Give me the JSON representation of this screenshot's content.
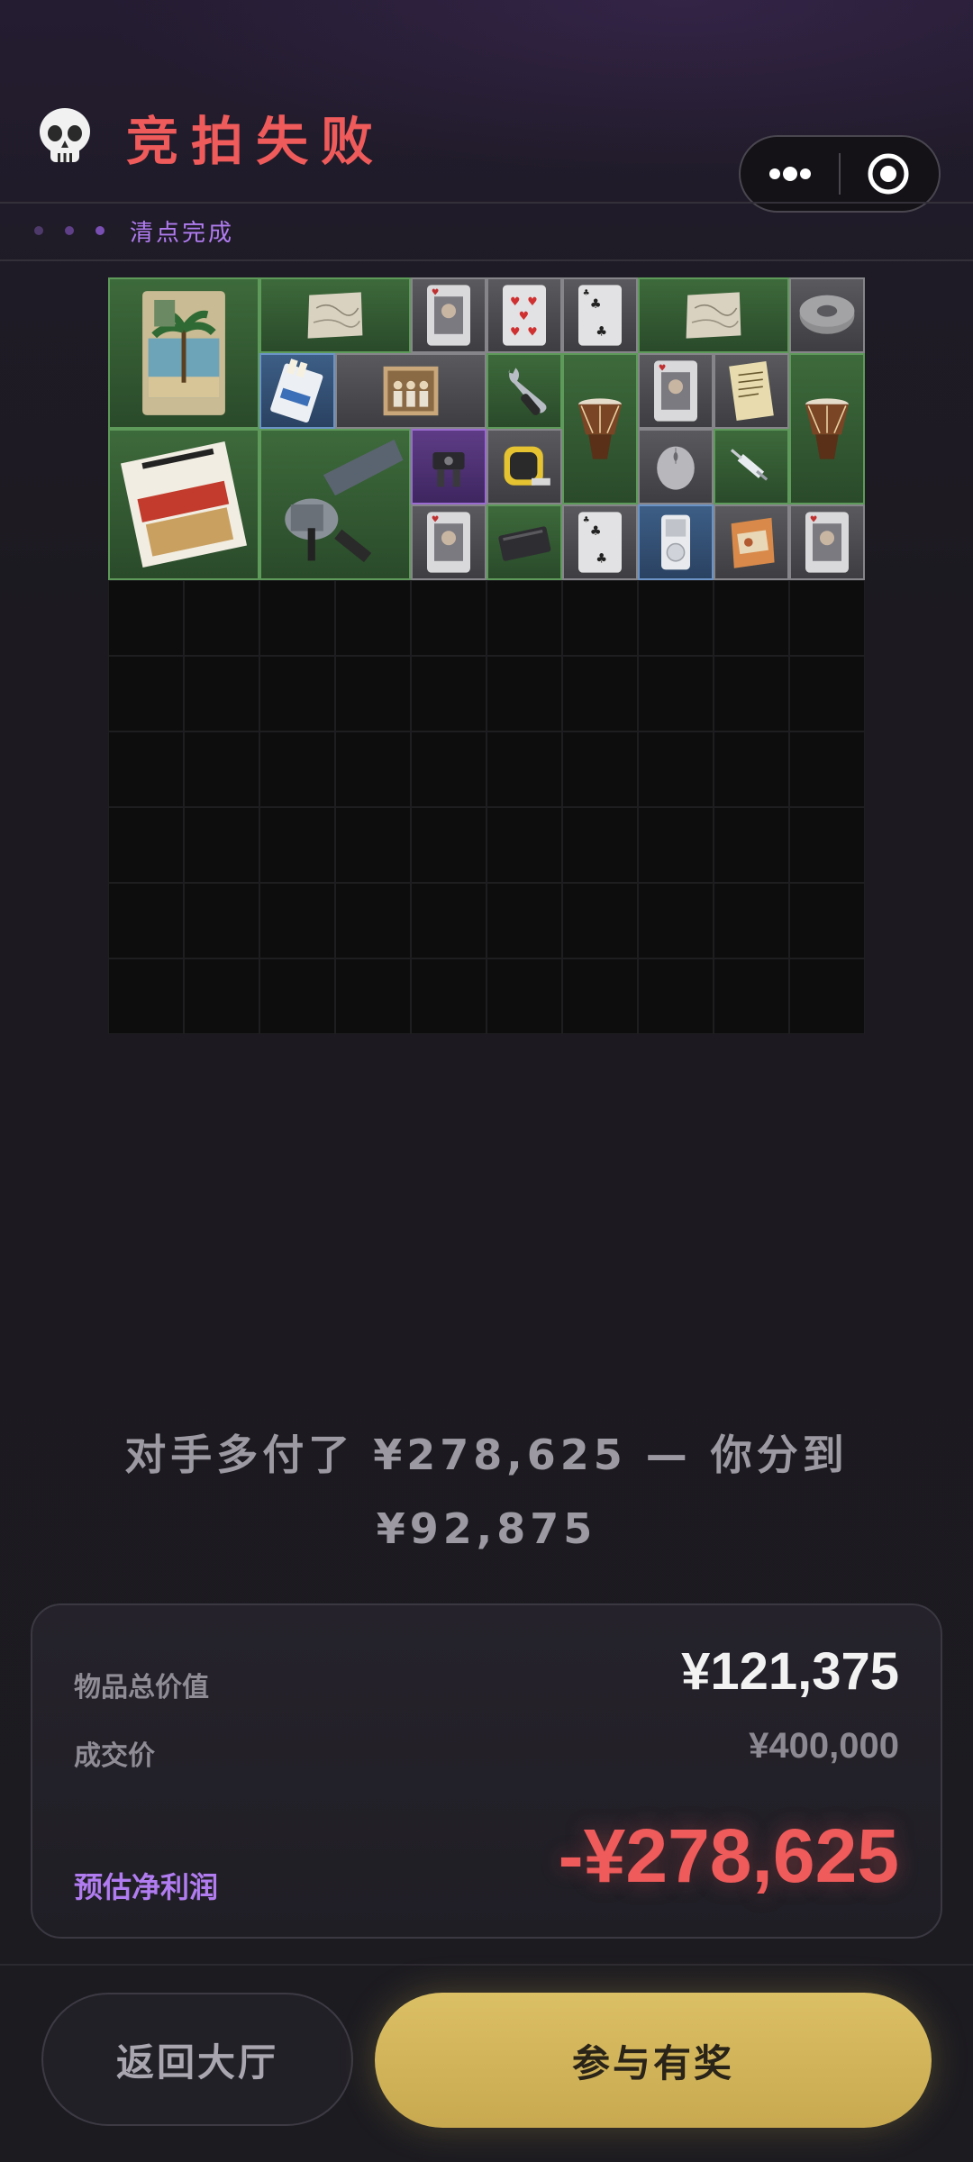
{
  "header": {
    "title": "竞拍失败",
    "status_label": "清点完成"
  },
  "colors": {
    "title": "#ef5a5a",
    "status": "#b07cf0",
    "loss": "#ef5a5a",
    "profit_label": "#b07cf0",
    "primary_button": "#d4b75c"
  },
  "grid": {
    "columns": 10,
    "rows": 10,
    "items": [
      {
        "name": "postcard",
        "col": 0,
        "row": 0,
        "w": 2,
        "h": 2,
        "rarity": "green",
        "icon": "postcard-icon"
      },
      {
        "name": "old-map",
        "col": 2,
        "row": 0,
        "w": 2,
        "h": 1,
        "rarity": "green",
        "icon": "map-icon"
      },
      {
        "name": "playing-card",
        "col": 4,
        "row": 0,
        "w": 1,
        "h": 1,
        "rarity": "gray",
        "icon": "card-face-icon"
      },
      {
        "name": "playing-card",
        "col": 5,
        "row": 0,
        "w": 1,
        "h": 1,
        "rarity": "gray",
        "icon": "card-hearts-icon"
      },
      {
        "name": "playing-card",
        "col": 6,
        "row": 0,
        "w": 1,
        "h": 1,
        "rarity": "gray",
        "icon": "card-clubs-icon"
      },
      {
        "name": "old-map",
        "col": 7,
        "row": 0,
        "w": 2,
        "h": 1,
        "rarity": "green",
        "icon": "map-icon"
      },
      {
        "name": "duct-tape",
        "col": 9,
        "row": 0,
        "w": 1,
        "h": 1,
        "rarity": "gray",
        "icon": "tape-roll-icon"
      },
      {
        "name": "cigarette-pack",
        "col": 2,
        "row": 1,
        "w": 1,
        "h": 1,
        "rarity": "blue",
        "icon": "cigarette-pack-icon"
      },
      {
        "name": "old-photo",
        "col": 3,
        "row": 1,
        "w": 2,
        "h": 1,
        "rarity": "gray",
        "icon": "photo-icon"
      },
      {
        "name": "wrench",
        "col": 5,
        "row": 1,
        "w": 1,
        "h": 1,
        "rarity": "green",
        "icon": "wrench-icon"
      },
      {
        "name": "drum",
        "col": 6,
        "row": 1,
        "w": 1,
        "h": 2,
        "rarity": "green",
        "icon": "drum-icon"
      },
      {
        "name": "playing-card",
        "col": 7,
        "row": 1,
        "w": 1,
        "h": 1,
        "rarity": "gray",
        "icon": "card-face-icon"
      },
      {
        "name": "document",
        "col": 8,
        "row": 1,
        "w": 1,
        "h": 1,
        "rarity": "gray",
        "icon": "document-icon"
      },
      {
        "name": "drum",
        "col": 9,
        "row": 1,
        "w": 1,
        "h": 2,
        "rarity": "green",
        "icon": "drum-icon"
      },
      {
        "name": "magazine",
        "col": 0,
        "row": 2,
        "w": 2,
        "h": 2,
        "rarity": "green",
        "icon": "magazine-icon"
      },
      {
        "name": "angle-grinder",
        "col": 2,
        "row": 2,
        "w": 2,
        "h": 2,
        "rarity": "green",
        "icon": "grinder-icon"
      },
      {
        "name": "gadget",
        "col": 4,
        "row": 2,
        "w": 1,
        "h": 1,
        "rarity": "purple",
        "icon": "gadget-icon"
      },
      {
        "name": "tape-measure",
        "col": 5,
        "row": 2,
        "w": 1,
        "h": 1,
        "rarity": "gray",
        "icon": "tape-measure-icon"
      },
      {
        "name": "mouse",
        "col": 7,
        "row": 2,
        "w": 1,
        "h": 1,
        "rarity": "gray",
        "icon": "mouse-icon"
      },
      {
        "name": "syringe",
        "col": 8,
        "row": 2,
        "w": 1,
        "h": 1,
        "rarity": "green",
        "icon": "syringe-icon"
      },
      {
        "name": "playing-card",
        "col": 4,
        "row": 3,
        "w": 1,
        "h": 1,
        "rarity": "gray",
        "icon": "card-face-icon"
      },
      {
        "name": "hard-drive",
        "col": 5,
        "row": 3,
        "w": 1,
        "h": 1,
        "rarity": "green",
        "icon": "hard-drive-icon"
      },
      {
        "name": "playing-card",
        "col": 6,
        "row": 3,
        "w": 1,
        "h": 1,
        "rarity": "gray",
        "icon": "card-clubs-icon"
      },
      {
        "name": "mp3-player",
        "col": 7,
        "row": 3,
        "w": 1,
        "h": 1,
        "rarity": "blue",
        "icon": "mp3-player-icon"
      },
      {
        "name": "snack-bag",
        "col": 8,
        "row": 3,
        "w": 1,
        "h": 1,
        "rarity": "gray",
        "icon": "snack-bag-icon"
      },
      {
        "name": "playing-card",
        "col": 9,
        "row": 3,
        "w": 1,
        "h": 1,
        "rarity": "gray",
        "icon": "card-face-icon"
      }
    ]
  },
  "summary": {
    "line1": "对手多付了 ¥278,625 — 你分到",
    "line2": "¥92,875"
  },
  "card": {
    "total_label": "物品总价值",
    "total_value": "¥121,375",
    "deal_label": "成交价",
    "deal_value": "¥400,000",
    "profit_label": "预估净利润",
    "profit_value": "-¥278,625"
  },
  "buttons": {
    "back": "返回大厅",
    "join": "参与有奖"
  }
}
